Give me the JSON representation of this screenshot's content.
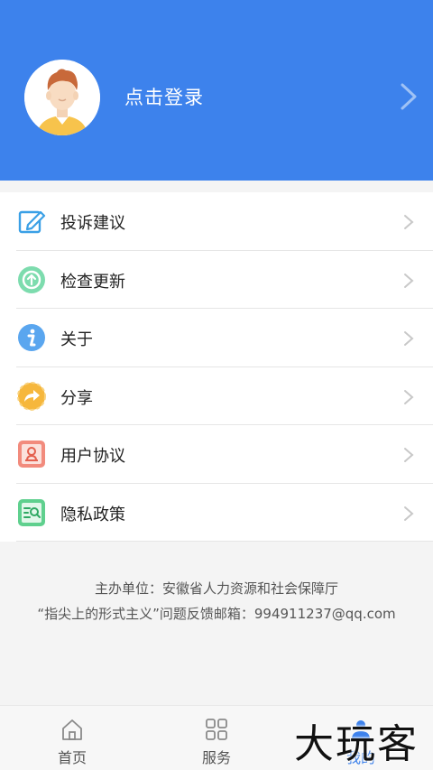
{
  "header": {
    "login_label": "点击登录"
  },
  "menu": {
    "items": [
      {
        "label": "投诉建议",
        "icon": "edit-icon"
      },
      {
        "label": "检查更新",
        "icon": "update-icon"
      },
      {
        "label": "关于",
        "icon": "info-icon"
      },
      {
        "label": "分享",
        "icon": "share-icon"
      },
      {
        "label": "用户协议",
        "icon": "user-agreement-icon"
      },
      {
        "label": "隐私政策",
        "icon": "privacy-policy-icon"
      }
    ]
  },
  "footer": {
    "sponsor": "主办单位：安徽省人力资源和社会保障厅",
    "feedback": "“指尖上的形式主义”问题反馈邮箱：994911237@qq.com"
  },
  "tabbar": {
    "tabs": [
      {
        "label": "首页",
        "icon": "home-icon",
        "active": false
      },
      {
        "label": "服务",
        "icon": "grid-icon",
        "active": false
      },
      {
        "label": "我的",
        "icon": "user-icon",
        "active": true
      }
    ]
  },
  "watermark": "大玩客",
  "colors": {
    "accent": "#3d82ec",
    "header_bg": "#3d82ec",
    "page_bg": "#f4f4f4"
  }
}
